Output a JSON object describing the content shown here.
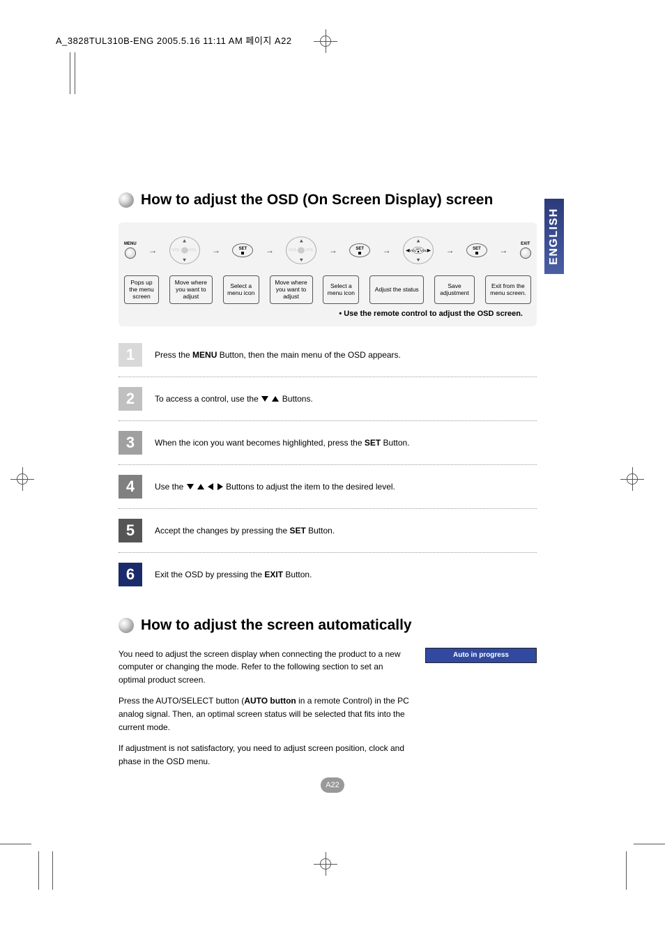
{
  "header_stamp": "A_3828TUL310B-ENG  2005.5.16  11:11 AM  페이지 A22",
  "language_tab": "ENGLISH",
  "page_number": "A22",
  "section1": {
    "title": "How to adjust the OSD (On Screen Display) screen",
    "flow_labels": {
      "menu": "MENU",
      "set": "SET",
      "exit": "EXIT",
      "vol": "VOL"
    },
    "captions": [
      "Pops up the menu screen",
      "Move where you want to adjust",
      "Select a menu icon",
      "Move where you want to adjust",
      "Select a menu icon",
      "Adjust the status",
      "Save adjustment",
      "Exit from the menu screen."
    ],
    "note": "• Use the remote control to adjust the OSD screen.",
    "steps": [
      {
        "n": "1",
        "pre": "Press the ",
        "bold": "MENU",
        "post": " Button, then the main menu of the OSD appears."
      },
      {
        "n": "2",
        "pre": "To access a control, use the ",
        "icons": "du",
        "post": " Buttons."
      },
      {
        "n": "3",
        "pre": "When the icon you want becomes highlighted, press the ",
        "bold": "SET",
        "post": " Button."
      },
      {
        "n": "4",
        "pre": "Use the ",
        "icons": "dulr",
        "post": " Buttons to adjust the item to the desired level."
      },
      {
        "n": "5",
        "pre": "Accept the changes by pressing the ",
        "bold": "SET",
        "post": " Button."
      },
      {
        "n": "6",
        "pre": "Exit the OSD by pressing the ",
        "bold": "EXIT",
        "post": " Button."
      }
    ]
  },
  "section2": {
    "title": "How to adjust the screen automatically",
    "para1": "You need to adjust the screen display when connecting the product to a new computer or changing the mode. Refer to the following section to set an optimal product screen.",
    "para2_pre": "Press the AUTO/SELECT button (",
    "para2_bold": "AUTO button",
    "para2_post": " in a remote Control) in the PC analog signal. Then, an optimal screen status will be selected that fits into the current mode.",
    "para3": "If adjustment is not satisfactory, you need to adjust screen position, clock and phase in the OSD menu.",
    "auto_box": "Auto in progress"
  }
}
